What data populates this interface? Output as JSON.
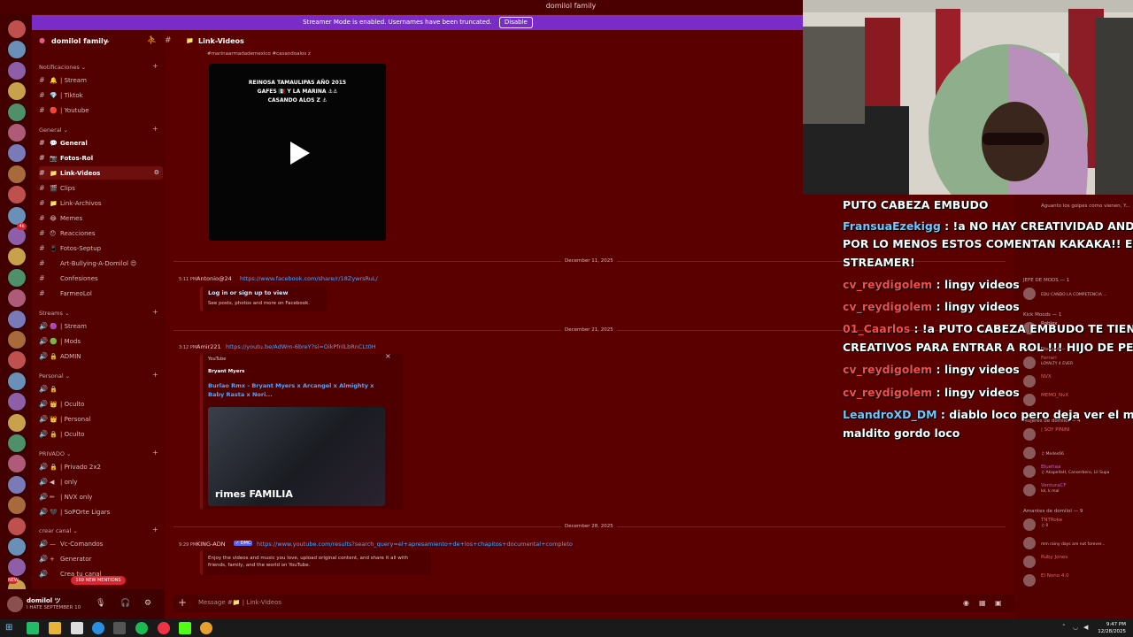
{
  "window": {
    "title": "domilol family"
  },
  "streamer_mode": {
    "message": "Streamer Mode is enabled. Usernames have been truncated.",
    "button": "Disable"
  },
  "server": {
    "name": "domilol family"
  },
  "sidebar": {
    "categories": [
      {
        "label": "Notificaciones",
        "channels": [
          {
            "emoji": "🔔",
            "name": "| Stream"
          },
          {
            "emoji": "💎",
            "name": "| Tiktok"
          },
          {
            "emoji": "🔴",
            "name": "| Youtube"
          }
        ]
      },
      {
        "label": "General",
        "channels": [
          {
            "emoji": "💬",
            "name": "General"
          },
          {
            "emoji": "📷",
            "name": "Fotos-Rol"
          },
          {
            "emoji": "📁",
            "name": "Link-Videos"
          },
          {
            "emoji": "🎬",
            "name": "Clips"
          },
          {
            "emoji": "📁",
            "name": "Link-Archivos"
          },
          {
            "emoji": "😂",
            "name": "Memes"
          },
          {
            "emoji": "😯",
            "name": "Reacciones"
          },
          {
            "emoji": "📱",
            "name": "Fotos-Septup"
          },
          {
            "emoji": "",
            "name": "Art-Bullying-A-Domilol 😍"
          },
          {
            "emoji": "",
            "name": "Confesiones"
          },
          {
            "emoji": "",
            "name": "FarmeoLol"
          }
        ]
      },
      {
        "label": "Streams",
        "channels": [
          {
            "emoji": "🟣",
            "name": "| Stream"
          },
          {
            "emoji": "🟢",
            "name": "| Mods"
          },
          {
            "emoji": "🔒",
            "name": "ADMIN"
          }
        ]
      },
      {
        "label": "Personal",
        "channels": [
          {
            "emoji": "🔒",
            "name": ""
          },
          {
            "emoji": "👑",
            "name": "| Oculto"
          },
          {
            "emoji": "👑",
            "name": "| Personal"
          },
          {
            "emoji": "🔒",
            "name": "| Oculto"
          }
        ]
      },
      {
        "label": "PRIVADO",
        "channels": [
          {
            "emoji": "🔒",
            "name": "| Privado 2x2"
          },
          {
            "emoji": "◀",
            "name": "| only"
          },
          {
            "emoji": "✏",
            "name": "| NVX only"
          },
          {
            "emoji": "🖤",
            "name": "| SoPOrte Ligars"
          }
        ]
      },
      {
        "label": "crear canal",
        "channels": [
          {
            "emoji": "—",
            "name": "Vc-Comandos"
          },
          {
            "emoji": "+",
            "name": "Generator"
          },
          {
            "emoji": "",
            "name": "Crea tu canal"
          }
        ]
      }
    ]
  },
  "mentions_badge": "169 NEW MENTIONS",
  "user": {
    "name": "domilol ツ",
    "status": "I HATE SEPTEMBER 10"
  },
  "channel": {
    "name": "Link-Videos"
  },
  "messages": {
    "video_caption_top": "#marinaarmadademexico #casandoalos z",
    "video_title_line1": "REINOSA TAMAULIPAS AÑO 2015",
    "video_title_line2": "GAFES 🇲🇽 Y LA MARINA ⚓⚓",
    "video_title_line3": "CASANDO ALOS Z ⚓",
    "date1": "December 11, 2025",
    "m1_time": "5:11 PM",
    "m1_author": "Antonio@24",
    "m1_link": "https://www.facebook.com/share/r/18ZywrsRuL/",
    "m1_embed_title": "Log in or sign up to view",
    "m1_embed_text": "See posts, photos and more on Facebook.",
    "date2": "December 21, 2025",
    "m2_time": "3:12 PM",
    "m2_author": "Amir221",
    "m2_link": "https://youtu.be/AdWm-6breY?si=OikPfnlLbRnCLt0H",
    "m2_provider": "YouTube",
    "m2_channel": "Bryant Myers",
    "m2_title_1": "Burlao Rmx - Bryant Myers x Arcangel x Almighty x",
    "m2_title_2": "Baby Rasta x Nori...",
    "m2_thumb_text": "rimes FAMILIA",
    "date3": "December 28, 2025",
    "m3_time": "9:29 PM",
    "m3_author": "KING-ADN",
    "m3_tag": "✓ DMC",
    "m3_link": "https://www.youtube.com/results?search_query=el+apresamiento+de+los+chapitos+documental+completo",
    "m3_text_1": "Enjoy the videos and music you love, upload original content, and share it all with",
    "m3_text_2": "friends, family, and the world on YouTube."
  },
  "composer": {
    "placeholder": "Message #📁 | Link-Videos"
  },
  "members": {
    "top_text": "Aguanto los golpes como vienen, Y...",
    "categories": [
      {
        "label": "JEFE DE MODS — 1",
        "rows": [
          {
            "name": "",
            "sub": "EDU CANDO LA COMPETENCIA ...",
            "color": "#e06666"
          }
        ]
      },
      {
        "label": "Kick Moods — 1",
        "rows": [
          {
            "name": "Roblox",
            "sub": "",
            "color": "#e0c0c0"
          }
        ]
      },
      {
        "label": "Admin-Discord — 3",
        "rows": [
          {
            "name": "Ferrari",
            "sub": "LOYALTY 4 EVER",
            "color": "#e06666"
          },
          {
            "name": "NVX",
            "sub": "",
            "color": "#e06666"
          },
          {
            "name": "MEMO_NvX",
            "sub": "",
            "color": "#e06666"
          }
        ]
      },
      {
        "label": "Mujeres de domilol — 4",
        "rows": [
          {
            "name": "| SOY PININI",
            "sub": "",
            "color": "#e06666"
          },
          {
            "name": "",
            "sub": "♫ Medes66",
            "color": "#e06666"
          },
          {
            "name": "Bluehaa",
            "sub": "♫ AkapellaH, Canserbero, Lil Supa",
            "color": "#c060c0"
          },
          {
            "name": "VenturaCF",
            "sub": "lol, k mal",
            "color": "#c060c0"
          }
        ]
      },
      {
        "label": "Amantes de domilol — 9",
        "rows": [
          {
            "name": "TNTRoke",
            "sub": "♫ 0",
            "color": "#e06666"
          },
          {
            "name": "",
            "sub": "mm rainy days are not forever...",
            "color": "#e06666"
          },
          {
            "name": "Ruby Jones",
            "sub": "",
            "color": "#e06666"
          },
          {
            "name": "El Nono 4.0",
            "sub": "",
            "color": "#e06666"
          }
        ]
      }
    ]
  },
  "stream_chat": [
    {
      "user": "",
      "user_color": "#ffffff",
      "text": "PUTO CABEZA EMBUDO"
    },
    {
      "user": "FransuaEzekigg",
      "user_color": "#6ec8ff",
      "text": ": !a NO HAY CREATIVIDAD AND"
    },
    {
      "user": "",
      "user_color": "#ffffff",
      "text": "POR LO MENOS ESTOS COMENTAN KAKAKA!! ESTAS"
    },
    {
      "user": "",
      "user_color": "#ffffff",
      "text": "STREAMER!"
    },
    {
      "user": "cv_reydigolem",
      "user_color": "#ff4a4a",
      "text": ": lingy videos"
    },
    {
      "user": "cv_reydigolem",
      "user_color": "#ff4a4a",
      "text": ": lingy videos"
    },
    {
      "user": "01_Caarlos",
      "user_color": "#ff4a4a",
      "text": ": !a PUTO CABEZA EMBUDO TE TIENEN"
    },
    {
      "user": "",
      "user_color": "#ffffff",
      "text": "CREATIVOS PARA ENTRAR A ROL !!! HIJO DE PERRA H"
    },
    {
      "user": "cv_reydigolem",
      "user_color": "#ff4a4a",
      "text": ": lingy videos"
    },
    {
      "user": "cv_reydigolem",
      "user_color": "#ff4a4a",
      "text": ": lingy videos"
    },
    {
      "user": "LeandroXD_DM",
      "user_color": "#6ec8ff",
      "text": ": diablo loco pero deja ver el maldito"
    },
    {
      "user": "",
      "user_color": "#ffffff",
      "text": "maldito gordo loco"
    }
  ],
  "guild_badges": [
    "4k",
    "NEW"
  ],
  "clock": {
    "time": "9:47 PM",
    "date": "12/28/2025"
  },
  "colors": {
    "accent": "#7a2cc9",
    "background": "#5a0000",
    "link": "#4ea6ff"
  }
}
